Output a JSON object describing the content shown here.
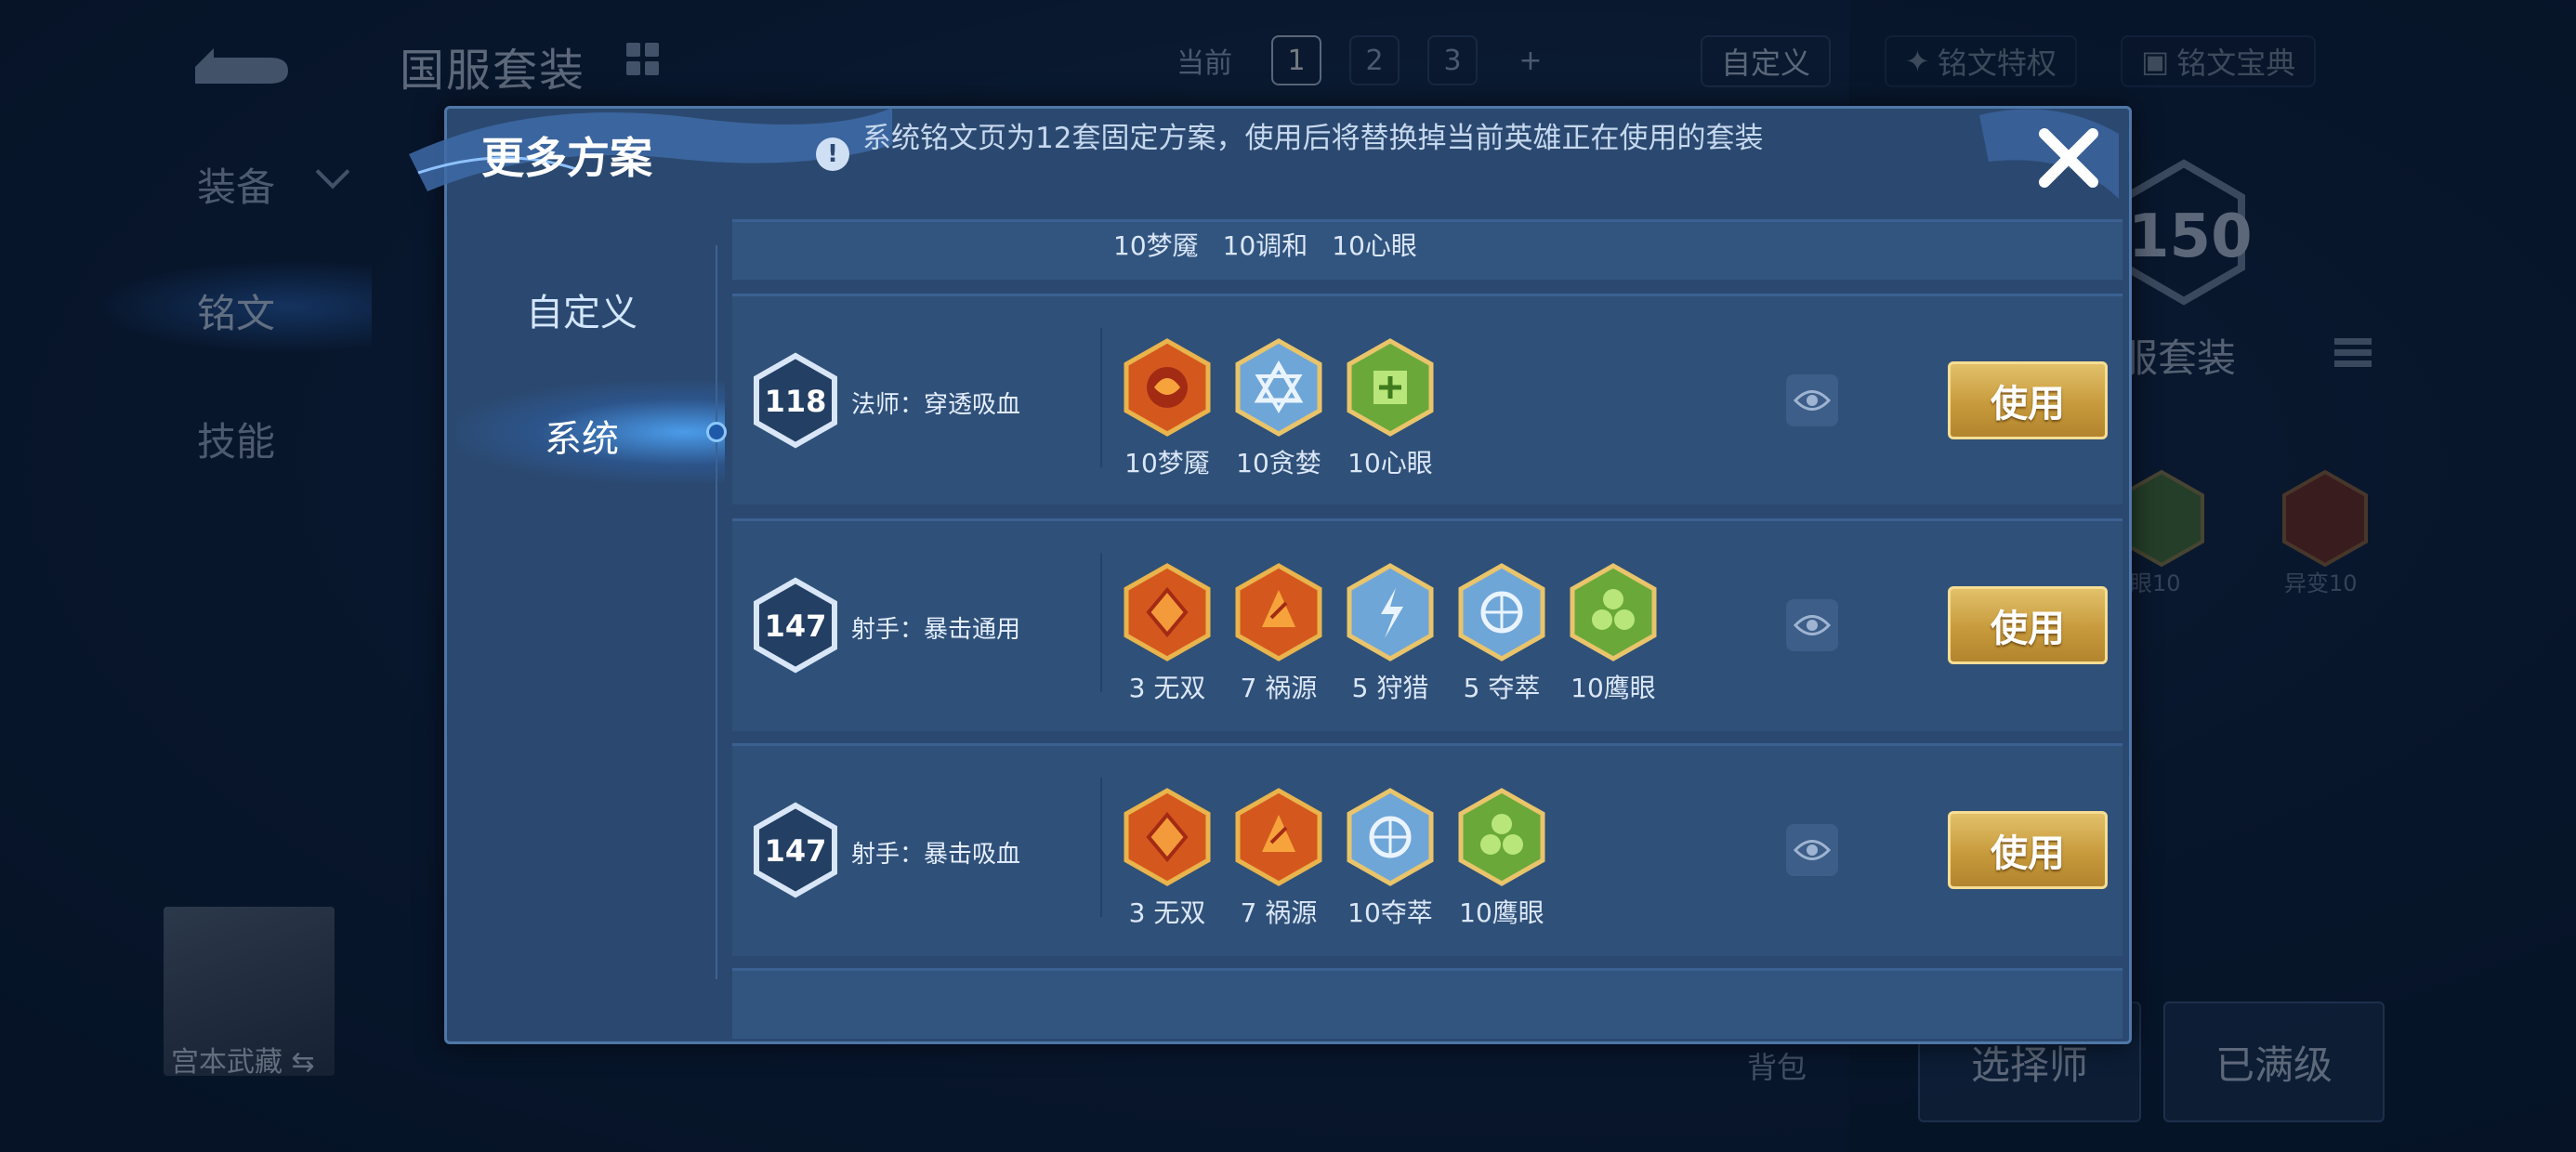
{
  "background": {
    "title": "国服套装",
    "sidebar": [
      "装备",
      "铭文",
      "技能"
    ],
    "page_label_current": "当前",
    "pages": [
      "1",
      "2",
      "3",
      "+"
    ],
    "custom_label": "自定义",
    "links": [
      "铭文特权",
      "铭文宝典"
    ],
    "level_value": "150",
    "right_title": "服套装",
    "runes": [
      {
        "label": "眼10"
      },
      {
        "label": "异变10"
      }
    ],
    "hero_name": "宫本武藏",
    "bag_label": "背包",
    "buttons": [
      "选择师",
      "已满级"
    ]
  },
  "modal": {
    "title": "更多方案",
    "notice": "系统铭文页为12套固定方案，使用后将替换掉当前英雄正在使用的套装",
    "tabs": [
      "自定义",
      "系统"
    ],
    "active_tab": "系统",
    "partial_top_labels": [
      "10梦魇",
      "10调和",
      "10心眼"
    ],
    "rows": [
      {
        "level": "118",
        "name": "法师：穿透吸血",
        "runes": [
          {
            "label": "10梦魇",
            "color": "#d4581e",
            "icon": "crimson-rune-icon"
          },
          {
            "label": "10贪婪",
            "color": "#6fa6d8",
            "icon": "blue-rune-icon"
          },
          {
            "label": "10心眼",
            "color": "#6aa83a",
            "icon": "green-rune-icon"
          }
        ],
        "use_label": "使用"
      },
      {
        "level": "147",
        "name": "射手：暴击通用",
        "runes": [
          {
            "label": "3 无双",
            "color": "#d4581e",
            "icon": "crimson-rune-icon"
          },
          {
            "label": "7 祸源",
            "color": "#d4581e",
            "icon": "crimson-rune-icon"
          },
          {
            "label": "5 狩猎",
            "color": "#6fa6d8",
            "icon": "blue-rune-icon"
          },
          {
            "label": "5 夺萃",
            "color": "#6fa6d8",
            "icon": "blue-rune-icon"
          },
          {
            "label": "10鹰眼",
            "color": "#6aa83a",
            "icon": "green-rune-icon"
          }
        ],
        "use_label": "使用"
      },
      {
        "level": "147",
        "name": "射手：暴击吸血",
        "runes": [
          {
            "label": "3 无双",
            "color": "#d4581e",
            "icon": "crimson-rune-icon"
          },
          {
            "label": "7 祸源",
            "color": "#d4581e",
            "icon": "crimson-rune-icon"
          },
          {
            "label": "10夺萃",
            "color": "#6fa6d8",
            "icon": "blue-rune-icon"
          },
          {
            "label": "10鹰眼",
            "color": "#6aa83a",
            "icon": "green-rune-icon"
          }
        ],
        "use_label": "使用"
      }
    ]
  },
  "colors": {
    "accent_gold": "#c79a3c",
    "panel_blue": "#2b4970",
    "row_blue": "#2f5078"
  }
}
